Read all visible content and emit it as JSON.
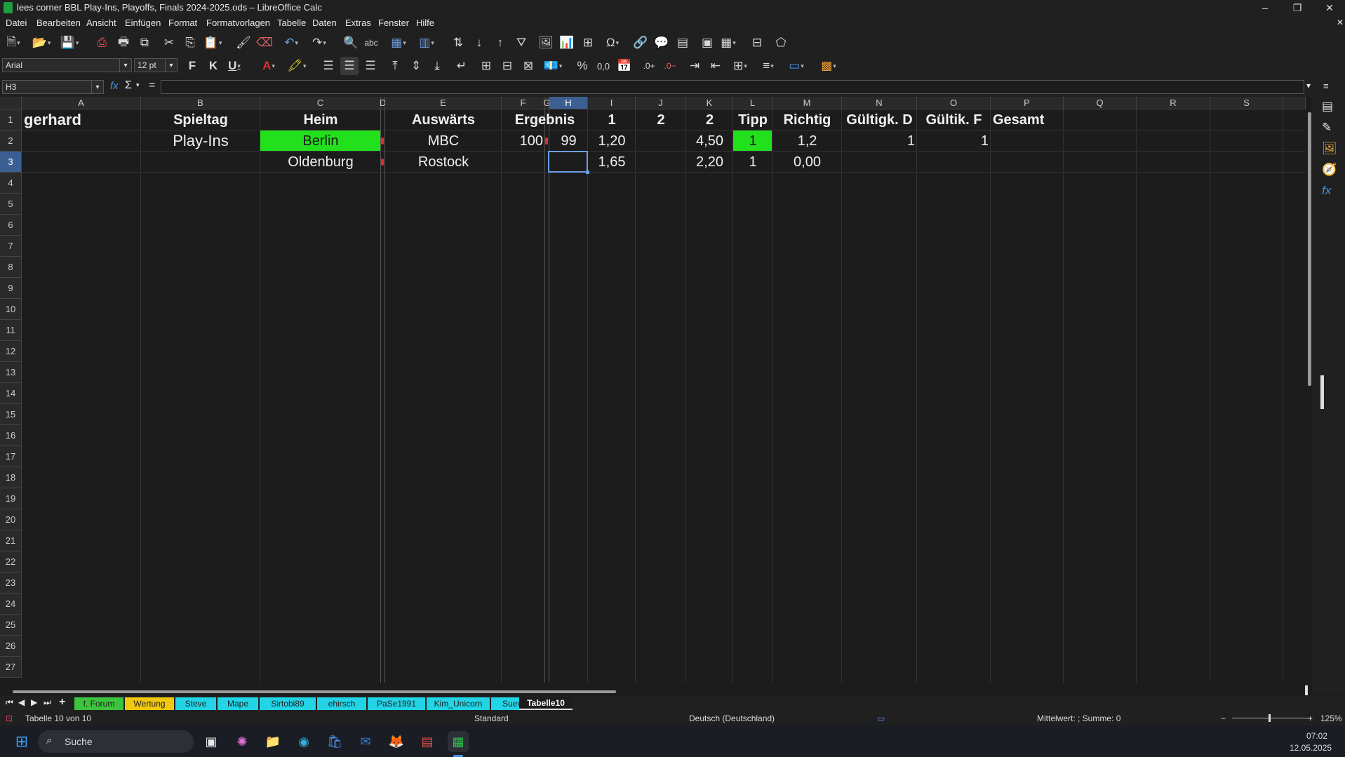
{
  "window": {
    "title": "lees corner BBL Play-Ins, Playoffs, Finals 2024-2025.ods – LibreOffice Calc",
    "controls": {
      "minimize": "–",
      "maximize": "❐",
      "close": "✕"
    }
  },
  "menu": [
    "Datei",
    "Bearbeiten",
    "Ansicht",
    "Einfügen",
    "Format",
    "Formatvorlagen",
    "Tabelle",
    "Daten",
    "Extras",
    "Fenster",
    "Hilfe"
  ],
  "toolbar": {
    "font_name": "Arial",
    "font_size": "12 pt",
    "bold": "F",
    "italic": "K",
    "underline": "U",
    "percent": "%",
    "number": "0,0"
  },
  "formula_bar": {
    "name_box": "H3",
    "fx": "fx",
    "sigma": "Σ",
    "equals": "=",
    "content": ""
  },
  "sheet": {
    "columns": [
      "A",
      "B",
      "C",
      "D",
      "E",
      "F",
      "G",
      "H",
      "I",
      "J",
      "K",
      "L",
      "M",
      "N",
      "O",
      "P",
      "Q",
      "R",
      "S"
    ],
    "selected_column": "H",
    "selected_row": "3",
    "rows": [
      "1",
      "2",
      "3",
      "4",
      "5",
      "6",
      "7",
      "8",
      "9",
      "10",
      "11",
      "12",
      "13",
      "14",
      "15",
      "16",
      "17",
      "18",
      "19",
      "20",
      "21",
      "22",
      "23",
      "24",
      "25",
      "26",
      "27"
    ],
    "cells": {
      "A1": "gerhard",
      "B1": "Spieltag",
      "C1": "Heim",
      "E1": "Auswärts",
      "F1": "Ergebnis",
      "I1": "1",
      "J1": "2",
      "K1": "2",
      "L1": "Tipp",
      "M1": "Richtig",
      "N1": "Gültigk. D",
      "O1": "Gültik. F",
      "P1": "Gesamt",
      "B2": "Play-Ins",
      "C2": "Berlin",
      "E2": "MBC",
      "F2": "100",
      "H2": "99",
      "I2": "1,20",
      "K2": "4,50",
      "L2": "1",
      "M2": "1,2",
      "N2": "1",
      "O2": "1",
      "C3": "Oldenburg",
      "E3": "Rostock",
      "I3": "1,65",
      "K3": "2,20",
      "L3": "1",
      "M3": "0,00"
    },
    "highlight_color": "#22e01c"
  },
  "sheet_tabs": [
    {
      "label": "f. Forum",
      "color": "#3cc43c"
    },
    {
      "label": "Wertung",
      "color": "#f2c80f"
    },
    {
      "label": "Steve",
      "color": "#22d4e6"
    },
    {
      "label": "Mape",
      "color": "#22d4e6"
    },
    {
      "label": "Sirtobi89",
      "color": "#22d4e6"
    },
    {
      "label": "ehirsch",
      "color": "#22d4e6"
    },
    {
      "label": "PaSe1991",
      "color": "#22d4e6"
    },
    {
      "label": "Kim_Unicorn",
      "color": "#22d4e6"
    },
    {
      "label": "Sueviti",
      "color": "#22d4e6"
    },
    {
      "label": "Tabelle10",
      "color": "#1c1c1c"
    }
  ],
  "status_bar": {
    "sheet_info": "Tabelle 10 von 10",
    "style": "Standard",
    "language": "Deutsch (Deutschland)",
    "summary": "Mittelwert: ; Summe: 0",
    "zoom": "125%"
  },
  "taskbar": {
    "search_placeholder": "Suche",
    "time": "07:02",
    "date": "12.05.2025"
  }
}
